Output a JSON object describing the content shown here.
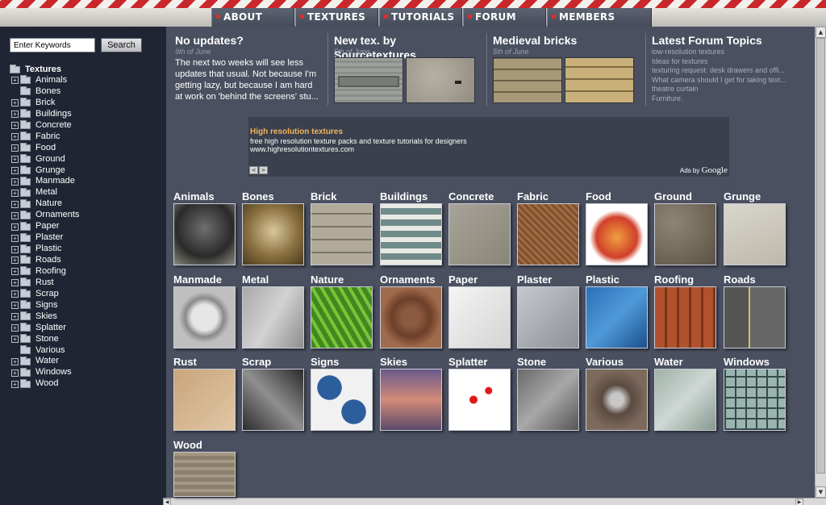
{
  "nav": {
    "items": [
      "ABOUT",
      "TEXTURES",
      "TUTORIALS",
      "FORUM",
      "MEMBERS"
    ]
  },
  "sidebar": {
    "search_placeholder": "Enter Keywords",
    "search_button": "Search",
    "tree_root": "Textures",
    "items": [
      "Animals",
      "Bones",
      "Brick",
      "Buildings",
      "Concrete",
      "Fabric",
      "Food",
      "Ground",
      "Grunge",
      "Manmade",
      "Metal",
      "Nature",
      "Ornaments",
      "Paper",
      "Plaster",
      "Plastic",
      "Roads",
      "Roofing",
      "Rust",
      "Scrap",
      "Signs",
      "Skies",
      "Splatter",
      "Stone",
      "Various",
      "Water",
      "Windows",
      "Wood"
    ]
  },
  "news": [
    {
      "title": "No updates?",
      "date": "9th of June",
      "body": "The next two weeks will see less updates that usual. Not because I'm getting lazy, but because I am hard at work on 'behind the screens' stu..."
    },
    {
      "title": "New tex. by Sourcetextures",
      "date": "5th of June"
    },
    {
      "title": "Medieval bricks",
      "date": "5th of June"
    },
    {
      "title": "Latest Forum Topics",
      "topics": [
        "low-resolution textures",
        "Ideas for textures",
        "texturing request: desk drawers and offi...",
        "What camera should I get for taking text...",
        "theatre curtain",
        "Furniture."
      ]
    }
  ],
  "ad": {
    "title": "High resolution textures",
    "line1": "free high resolution texture packs and texture tutorials for designers",
    "line2": "www.highresolutiontextures.com",
    "ads_by": "Ads by",
    "ads_brand": "Google"
  },
  "categories": [
    "Animals",
    "Bones",
    "Brick",
    "Buildings",
    "Concrete",
    "Fabric",
    "Food",
    "Ground",
    "Grunge",
    "Manmade",
    "Metal",
    "Nature",
    "Ornaments",
    "Paper",
    "Plaster",
    "Plastic",
    "Roofing",
    "Roads",
    "Rust",
    "Scrap",
    "Signs",
    "Skies",
    "Splatter",
    "Stone",
    "Various",
    "Water",
    "Windows",
    "Wood"
  ],
  "colors": {
    "background": "#4a5060",
    "sidebar": "#1f2533",
    "nav_accent": "#d8302f",
    "ad_title": "#f3b35a"
  }
}
